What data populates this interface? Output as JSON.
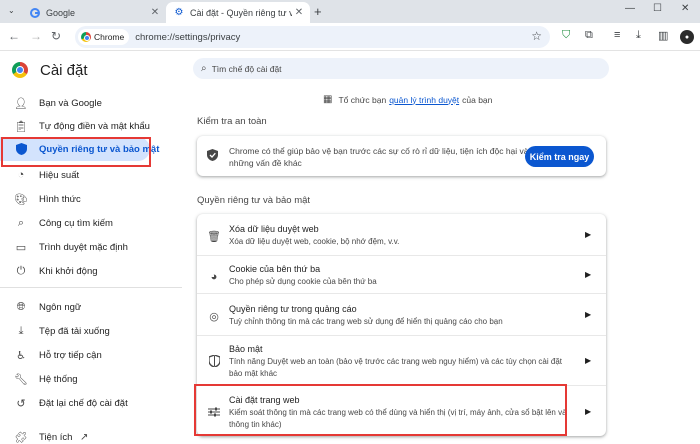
{
  "tabs": [
    {
      "title": "Google",
      "active": false
    },
    {
      "title": "Cài đặt - Quyền riêng tư và bảo mật",
      "active": true
    }
  ],
  "omnibox": {
    "chip": "Chrome",
    "url": "chrome://settings/privacy"
  },
  "app": {
    "title": "Cài đặt"
  },
  "sidebar": {
    "items": [
      {
        "label": "Bạn và Google",
        "icon": "person-icon"
      },
      {
        "label": "Tự động điền và mật khẩu",
        "icon": "clipboard-icon"
      },
      {
        "label": "Quyền riêng tư và bảo mật",
        "icon": "shield-icon",
        "active": true
      },
      {
        "label": "Hiệu suất",
        "icon": "speedometer-icon"
      },
      {
        "label": "Hình thức",
        "icon": "palette-icon"
      },
      {
        "label": "Công cụ tìm kiếm",
        "icon": "search-icon"
      },
      {
        "label": "Trình duyệt mặc định",
        "icon": "browser-icon"
      },
      {
        "label": "Khi khởi động",
        "icon": "power-icon"
      },
      {
        "label": "Ngôn ngữ",
        "icon": "globe-icon"
      },
      {
        "label": "Tệp đã tải xuống",
        "icon": "download-icon"
      },
      {
        "label": "Hỗ trợ tiếp cận",
        "icon": "accessibility-icon"
      },
      {
        "label": "Hệ thống",
        "icon": "wrench-icon"
      },
      {
        "label": "Đặt lại chế độ cài đặt",
        "icon": "reset-icon"
      },
      {
        "label": "Tiện ích",
        "icon": "puzzle-icon"
      }
    ]
  },
  "search": {
    "placeholder": "Tìm chế độ cài đặt"
  },
  "managed": {
    "prefix": "Tổ chức bạn",
    "link": "quản lý trình duyệt",
    "suffix": "của bạn"
  },
  "safety_check": {
    "title": "Kiểm tra an toàn",
    "text": "Chrome có thể giúp bảo vệ bạn trước các sự cố rò rỉ dữ liệu, tiện ích độc hại và những vấn đề khác",
    "button": "Kiểm tra ngay"
  },
  "privacy": {
    "title": "Quyền riêng tư và bảo mật",
    "rows": [
      {
        "title": "Xóa dữ liệu duyệt web",
        "desc": "Xóa dữ liệu duyệt web, cookie, bộ nhớ đệm, v.v.",
        "icon": "trash-icon"
      },
      {
        "title": "Cookie của bên thứ ba",
        "desc": "Cho phép sử dụng cookie của bên thứ ba",
        "icon": "cookie-icon"
      },
      {
        "title": "Quyền riêng tư trong quảng cáo",
        "desc": "Tuỳ chỉnh thông tin mà các trang web sử dụng để hiển thị quảng cáo cho bạn",
        "icon": "ads-privacy-icon"
      },
      {
        "title": "Bảo mật",
        "desc": "Tính năng Duyệt web an toàn (bảo vệ trước các trang web nguy hiểm) và các tùy chọn cài đặt bảo mật khác",
        "icon": "security-shield-icon"
      },
      {
        "title": "Cài đặt trang web",
        "desc": "Kiểm soát thông tin mà các trang web có thể dùng và hiển thị (vị trí, máy ảnh, cửa sổ bật lên và thông tin khác)",
        "icon": "sliders-icon"
      }
    ]
  },
  "colors": {
    "accent": "#0b57d0",
    "highlight_box": "#e53935",
    "active_bg": "#d3e3fd"
  }
}
